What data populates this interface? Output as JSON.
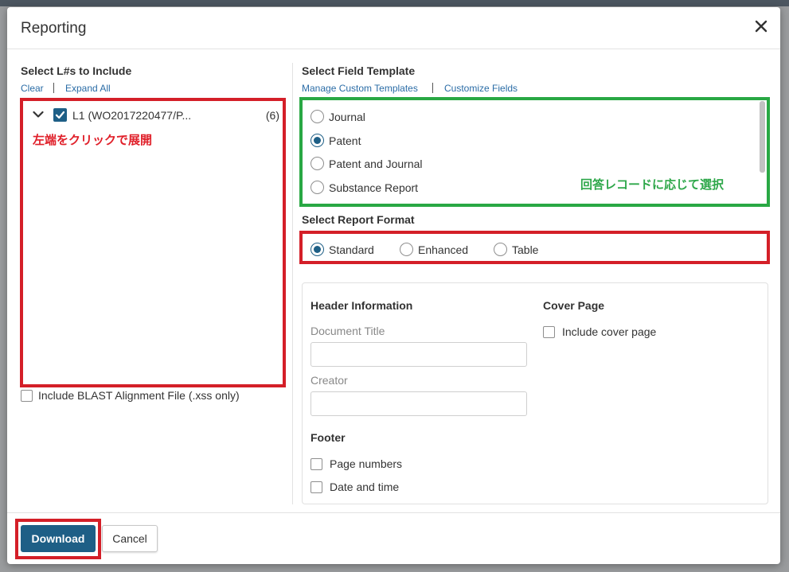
{
  "dialog": {
    "title": "Reporting"
  },
  "left": {
    "section_title": "Select L#s to Include",
    "clear_label": "Clear",
    "expand_all_label": "Expand All",
    "tree_item": {
      "label": "L1  (WO2017220477/P...",
      "count": "(6)",
      "checked": true
    },
    "annotation": "左端をクリックで展開",
    "blast_checkbox_label": "Include BLAST Alignment File (.xss only)"
  },
  "template": {
    "section_title": "Select Field Template",
    "manage_link": "Manage Custom Templates",
    "customize_link": "Customize Fields",
    "options": [
      "Journal",
      "Patent",
      "Patent and Journal",
      "Substance Report"
    ],
    "selected": "Patent",
    "annotation": "回答レコードに応じて選択"
  },
  "format": {
    "section_title": "Select Report Format",
    "options": [
      "Standard",
      "Enhanced",
      "Table"
    ],
    "selected": "Standard"
  },
  "header_info": {
    "title": "Header Information",
    "document_title_label": "Document Title",
    "document_title_value": "",
    "creator_label": "Creator",
    "creator_value": ""
  },
  "cover": {
    "title": "Cover Page",
    "include_label": "Include cover page"
  },
  "footer": {
    "title": "Footer",
    "page_numbers_label": "Page numbers",
    "date_time_label": "Date and time"
  },
  "buttons": {
    "download": "Download",
    "cancel": "Cancel"
  },
  "colors": {
    "primary": "#1e5f86",
    "annotation_red": "#d41f28",
    "annotation_green": "#29a844",
    "link": "#2a6ca6"
  }
}
